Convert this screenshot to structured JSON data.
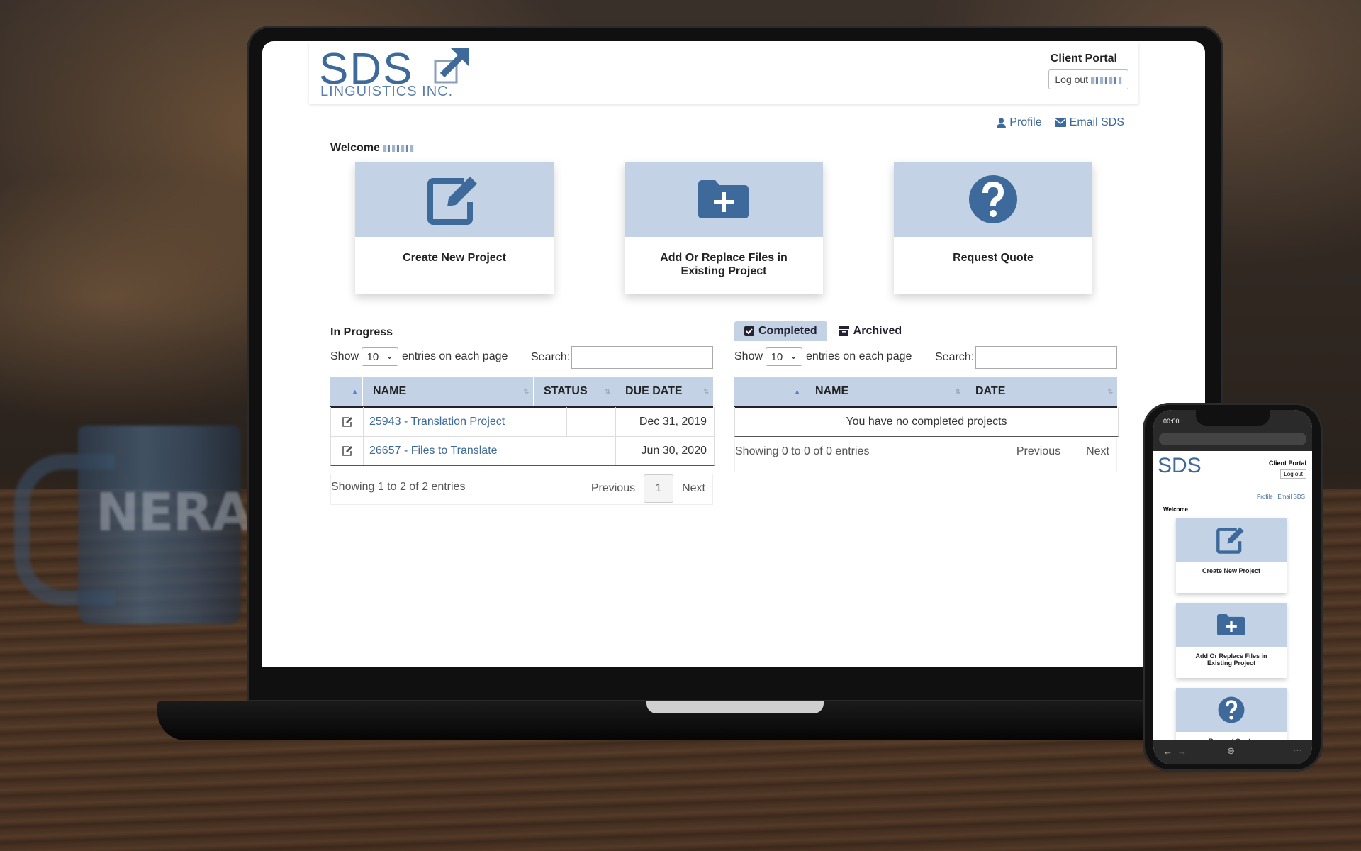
{
  "site": {
    "logo": {
      "name": "SDS",
      "subtitle": "LINGUISTICS INC."
    },
    "client_portal": "Client Portal",
    "logout_label": "Log out",
    "top_links": {
      "profile": "Profile",
      "email": "Email SDS"
    },
    "welcome": "Welcome"
  },
  "cards": [
    {
      "label": "Create New Project",
      "icon": "edit-icon"
    },
    {
      "label": "Add Or Replace Files in Existing Project",
      "icon": "folder-plus-icon"
    },
    {
      "label": "Request Quote",
      "icon": "question-circle-icon"
    }
  ],
  "in_progress": {
    "title": "In Progress",
    "show_label": "Show",
    "page_size": "10",
    "entries_label": "entries on each page",
    "search_label": "Search:",
    "columns": [
      "NAME",
      "STATUS",
      "DUE DATE"
    ],
    "rows": [
      {
        "name": "25943 - Translation Project",
        "status": "",
        "due": "Dec 31, 2019"
      },
      {
        "name": "26657 - Files to Translate",
        "status": "",
        "due": "Jun 30, 2020"
      }
    ],
    "summary": "Showing 1 to 2 of 2 entries",
    "prev": "Previous",
    "page": "1",
    "next": "Next"
  },
  "completed": {
    "tabs": [
      {
        "label": "Completed",
        "active": true
      },
      {
        "label": "Archived",
        "active": false
      }
    ],
    "show_label": "Show",
    "page_size": "10",
    "entries_label": "entries on each page",
    "search_label": "Search:",
    "columns": [
      "NAME",
      "DATE"
    ],
    "empty": "You have no completed projects",
    "summary": "Showing 0 to 0 of 0 entries",
    "prev": "Previous",
    "next": "Next"
  },
  "phone": {
    "time": "00:00",
    "client_portal": "Client Portal",
    "logout_label": "Log out",
    "profile": "Profile",
    "email": "Email SDS",
    "welcome": "Welcome",
    "cards": [
      "Create New Project",
      "Add Or Replace Files in Existing Project",
      "Request Quote"
    ]
  },
  "colors": {
    "accent": "#3d6a9a",
    "card_top": "#c3d3e5"
  }
}
